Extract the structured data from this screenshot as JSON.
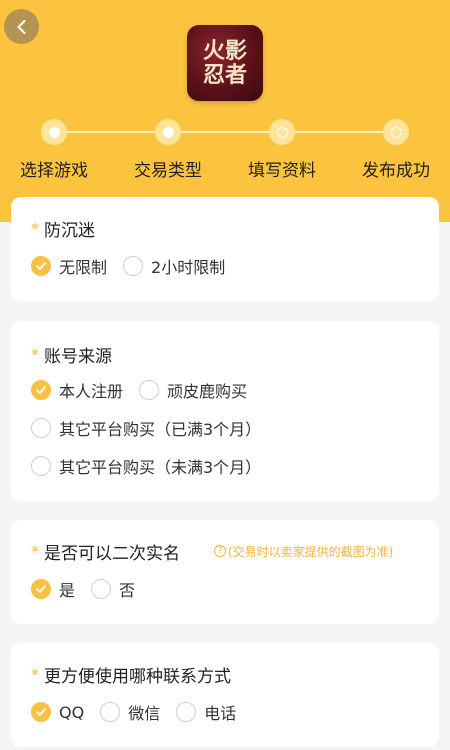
{
  "header": {
    "logo_text_line1": "火影",
    "logo_text_line2": "忍者"
  },
  "steps": [
    {
      "label": "选择游戏",
      "state": "done"
    },
    {
      "label": "交易类型",
      "state": "done"
    },
    {
      "label": "填写资料",
      "state": "pending"
    },
    {
      "label": "发布成功",
      "state": "pending"
    }
  ],
  "sections": {
    "anti_addiction": {
      "required_mark": "*",
      "title": "防沉迷",
      "options": [
        {
          "label": "无限制",
          "checked": true
        },
        {
          "label": "2小时限制",
          "checked": false
        }
      ]
    },
    "account_source": {
      "required_mark": "*",
      "title": "账号来源",
      "options": [
        {
          "label": "本人注册",
          "checked": true
        },
        {
          "label": "顽皮鹿购买",
          "checked": false
        },
        {
          "label": "其它平台购买（已满3个月）",
          "checked": false
        },
        {
          "label": "其它平台购买（未满3个月）",
          "checked": false
        }
      ]
    },
    "second_realname": {
      "required_mark": "*",
      "title": "是否可以二次实名",
      "hint": "(交易时以卖家提供的截图为准)",
      "hint_icon": "?",
      "options": [
        {
          "label": "是",
          "checked": true
        },
        {
          "label": "否",
          "checked": false
        }
      ]
    },
    "contact": {
      "required_mark": "*",
      "title": "更方便使用哪种联系方式",
      "options": [
        {
          "label": "QQ",
          "checked": true
        },
        {
          "label": "微信",
          "checked": false
        },
        {
          "label": "电话",
          "checked": false
        }
      ]
    }
  },
  "colors": {
    "accent": "#fcc33f",
    "check": "#f7c141",
    "hint": "#f2b43a"
  }
}
